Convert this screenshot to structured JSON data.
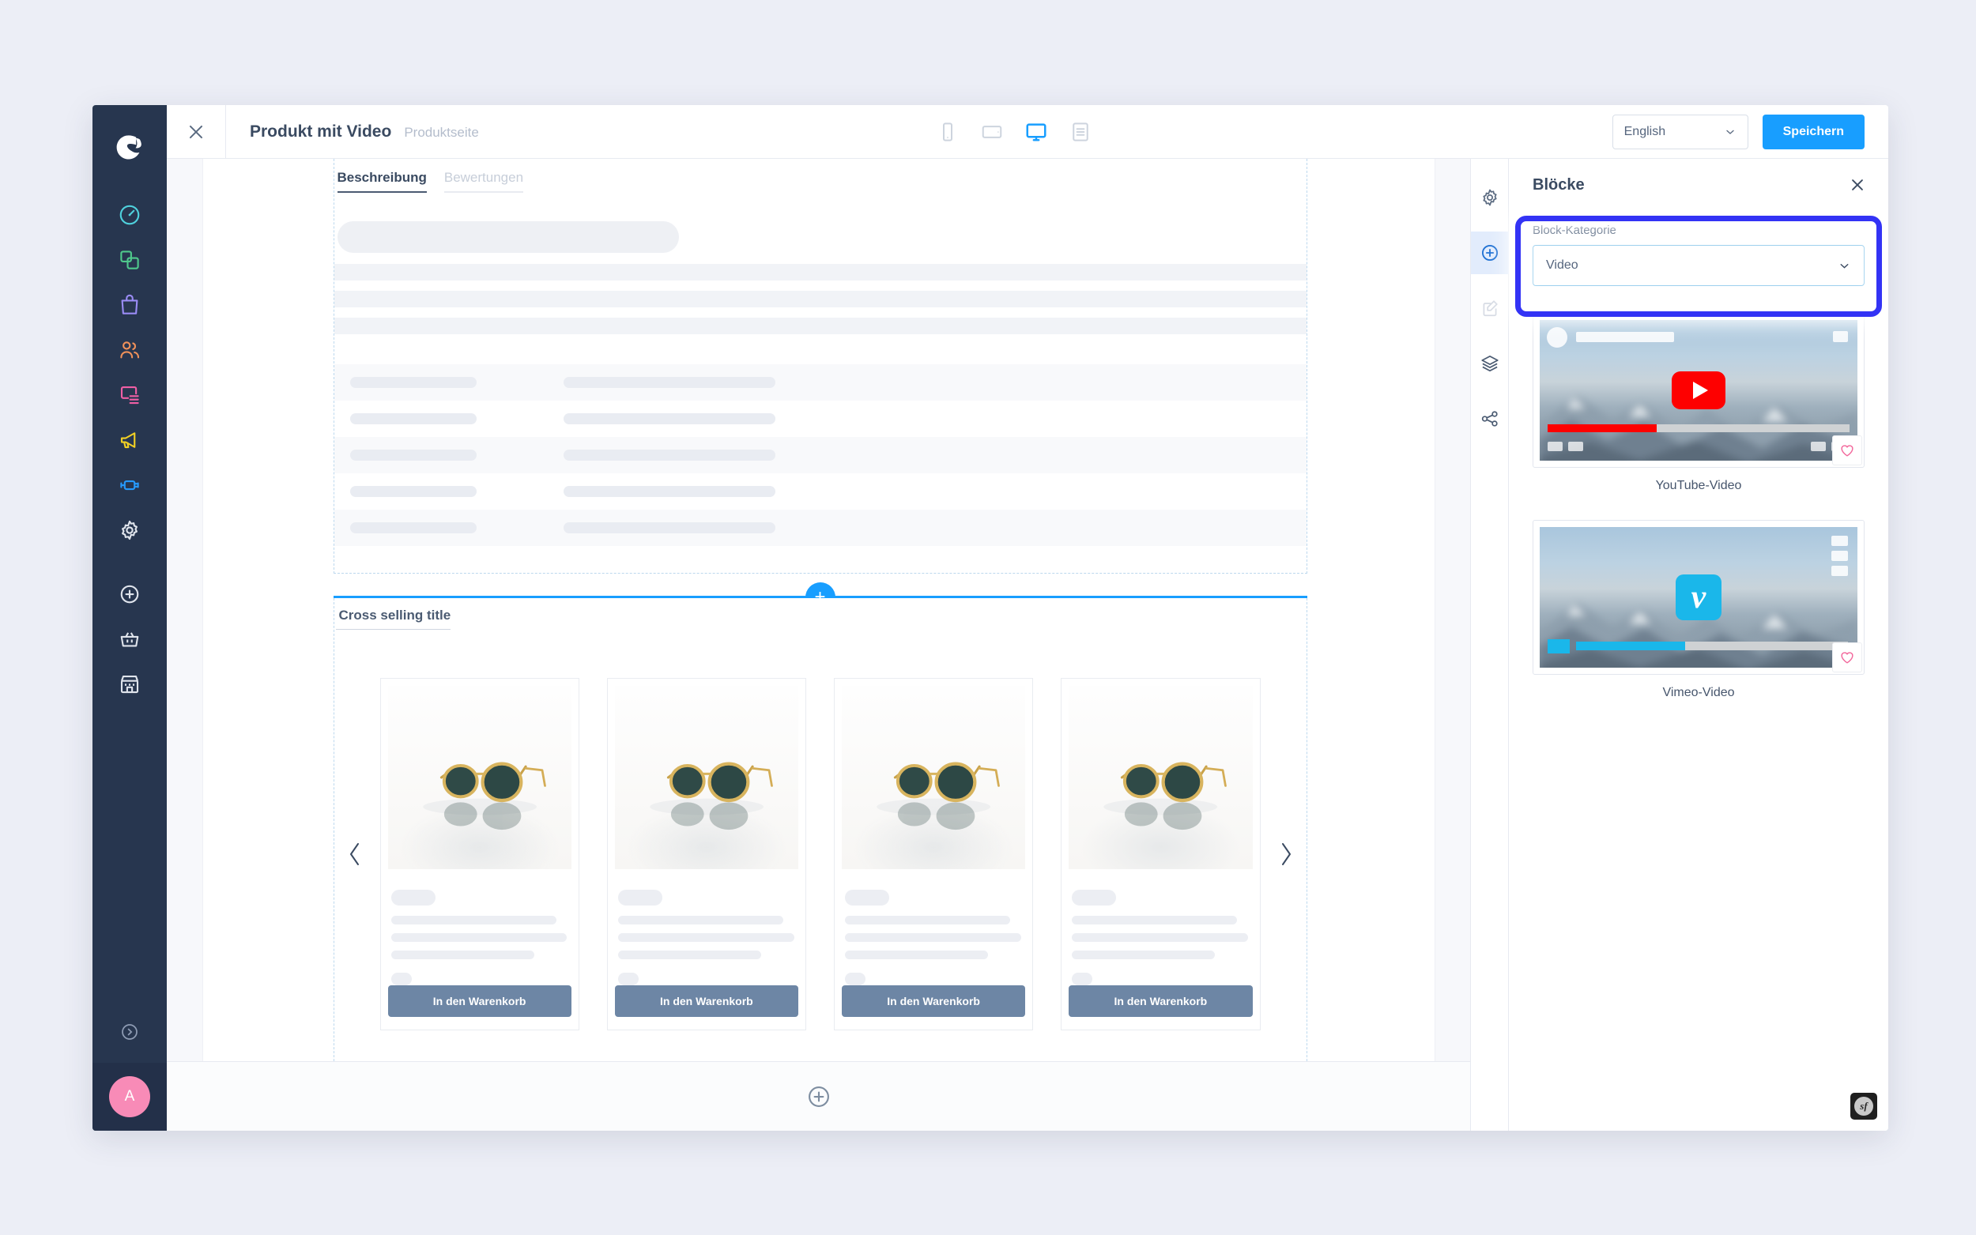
{
  "app": {
    "logo_icon": "shopware-logo-icon",
    "sidebar": {
      "items": [
        {
          "label": "Dashboard",
          "icon": "dashboard-gauge-icon",
          "color": "#4fd1dd"
        },
        {
          "label": "Kataloge",
          "icon": "catalogue-copy-icon",
          "color": "#4fc98c"
        },
        {
          "label": "Bestellungen",
          "icon": "orders-bag-icon",
          "color": "#9a8cf5"
        },
        {
          "label": "Kunden",
          "icon": "customers-people-icon",
          "color": "#f0915a"
        },
        {
          "label": "Inhalte",
          "icon": "content-layout-icon",
          "color": "#f05fa5"
        },
        {
          "label": "Marketing",
          "icon": "marketing-megaphone-icon",
          "color": "#f2d024"
        },
        {
          "label": "Erweiterungen",
          "icon": "extensions-plug-icon",
          "color": "#2699fb"
        },
        {
          "label": "Einstellungen",
          "icon": "settings-gear-icon",
          "color": "#dfe4ec"
        }
      ],
      "tools": [
        {
          "label": "Hinzufügen",
          "icon": "plus-circle-icon"
        },
        {
          "label": "Warenkorb",
          "icon": "basket-icon"
        },
        {
          "label": "Store",
          "icon": "store-icon"
        }
      ],
      "expand_icon": "chevron-right-circle-icon",
      "avatar_initial": "A",
      "avatar_color": "#f88bb7"
    }
  },
  "topbar": {
    "close_icon": "close-icon",
    "title": "Produkt mit Video",
    "subtitle": "Produktseite",
    "devices": [
      {
        "name": "mobile-device-icon",
        "label": "Mobil",
        "active": false
      },
      {
        "name": "tablet-device-icon",
        "label": "Tablet",
        "active": false
      },
      {
        "name": "desktop-device-icon",
        "label": "Desktop",
        "active": true
      },
      {
        "name": "form-view-icon",
        "label": "Formular",
        "active": false
      }
    ],
    "language": {
      "value": "English",
      "chevron_icon": "chevron-down-icon"
    },
    "save_label": "Speichern",
    "accent_color": "#189eff"
  },
  "canvas": {
    "description_block": {
      "tabs": [
        {
          "label": "Beschreibung",
          "active": true
        },
        {
          "label": "Bewertungen",
          "active": false
        }
      ],
      "skeleton_rows": 3,
      "table_rows": 5
    },
    "insert_indicator": {
      "icon": "plus-icon",
      "color": "#189eff"
    },
    "cross_selling": {
      "title": "Cross selling title",
      "prev_icon": "chevron-left-icon",
      "next_icon": "chevron-right-icon",
      "products": [
        {
          "image": "sunglasses-image",
          "cart_label": "In den Warenkorb"
        },
        {
          "image": "sunglasses-image",
          "cart_label": "In den Warenkorb"
        },
        {
          "image": "sunglasses-image",
          "cart_label": "In den Warenkorb"
        },
        {
          "image": "sunglasses-image",
          "cart_label": "In den Warenkorb"
        }
      ]
    },
    "footer_add_icon": "plus-circle-icon"
  },
  "right_rail": {
    "items": [
      {
        "icon": "gear-icon",
        "label": "Einstellungen",
        "active": false
      },
      {
        "icon": "plus-circle-icon",
        "label": "Blöcke",
        "active": true
      },
      {
        "icon": "edit-note-icon",
        "label": "Bearbeiten",
        "active": false
      },
      {
        "icon": "layers-icon",
        "label": "Ebenen",
        "active": false
      },
      {
        "icon": "share-nodes-icon",
        "label": "Teilen",
        "active": false
      }
    ]
  },
  "right_panel": {
    "title": "Blöcke",
    "close_icon": "close-icon",
    "category": {
      "label": "Block-Kategorie",
      "value": "Video",
      "chevron_icon": "chevron-down-icon",
      "highlighted": true,
      "highlight_color": "#3333f5"
    },
    "blocks": [
      {
        "label": "YouTube-Video",
        "badge": "youtube-play-icon",
        "badge_color": "#fe0000",
        "progress_color": "#fe0000",
        "progress_pct": 36,
        "favorite_icon": "heart-icon"
      },
      {
        "label": "Vimeo-Video",
        "badge": "vimeo-logo-icon",
        "badge_color": "#1ab7ea",
        "progress_color": "#1ab7ea",
        "progress_pct": 40,
        "favorite_icon": "heart-icon"
      }
    ]
  },
  "debug_badge": {
    "icon": "symfony-logo-icon",
    "text": "sf"
  }
}
